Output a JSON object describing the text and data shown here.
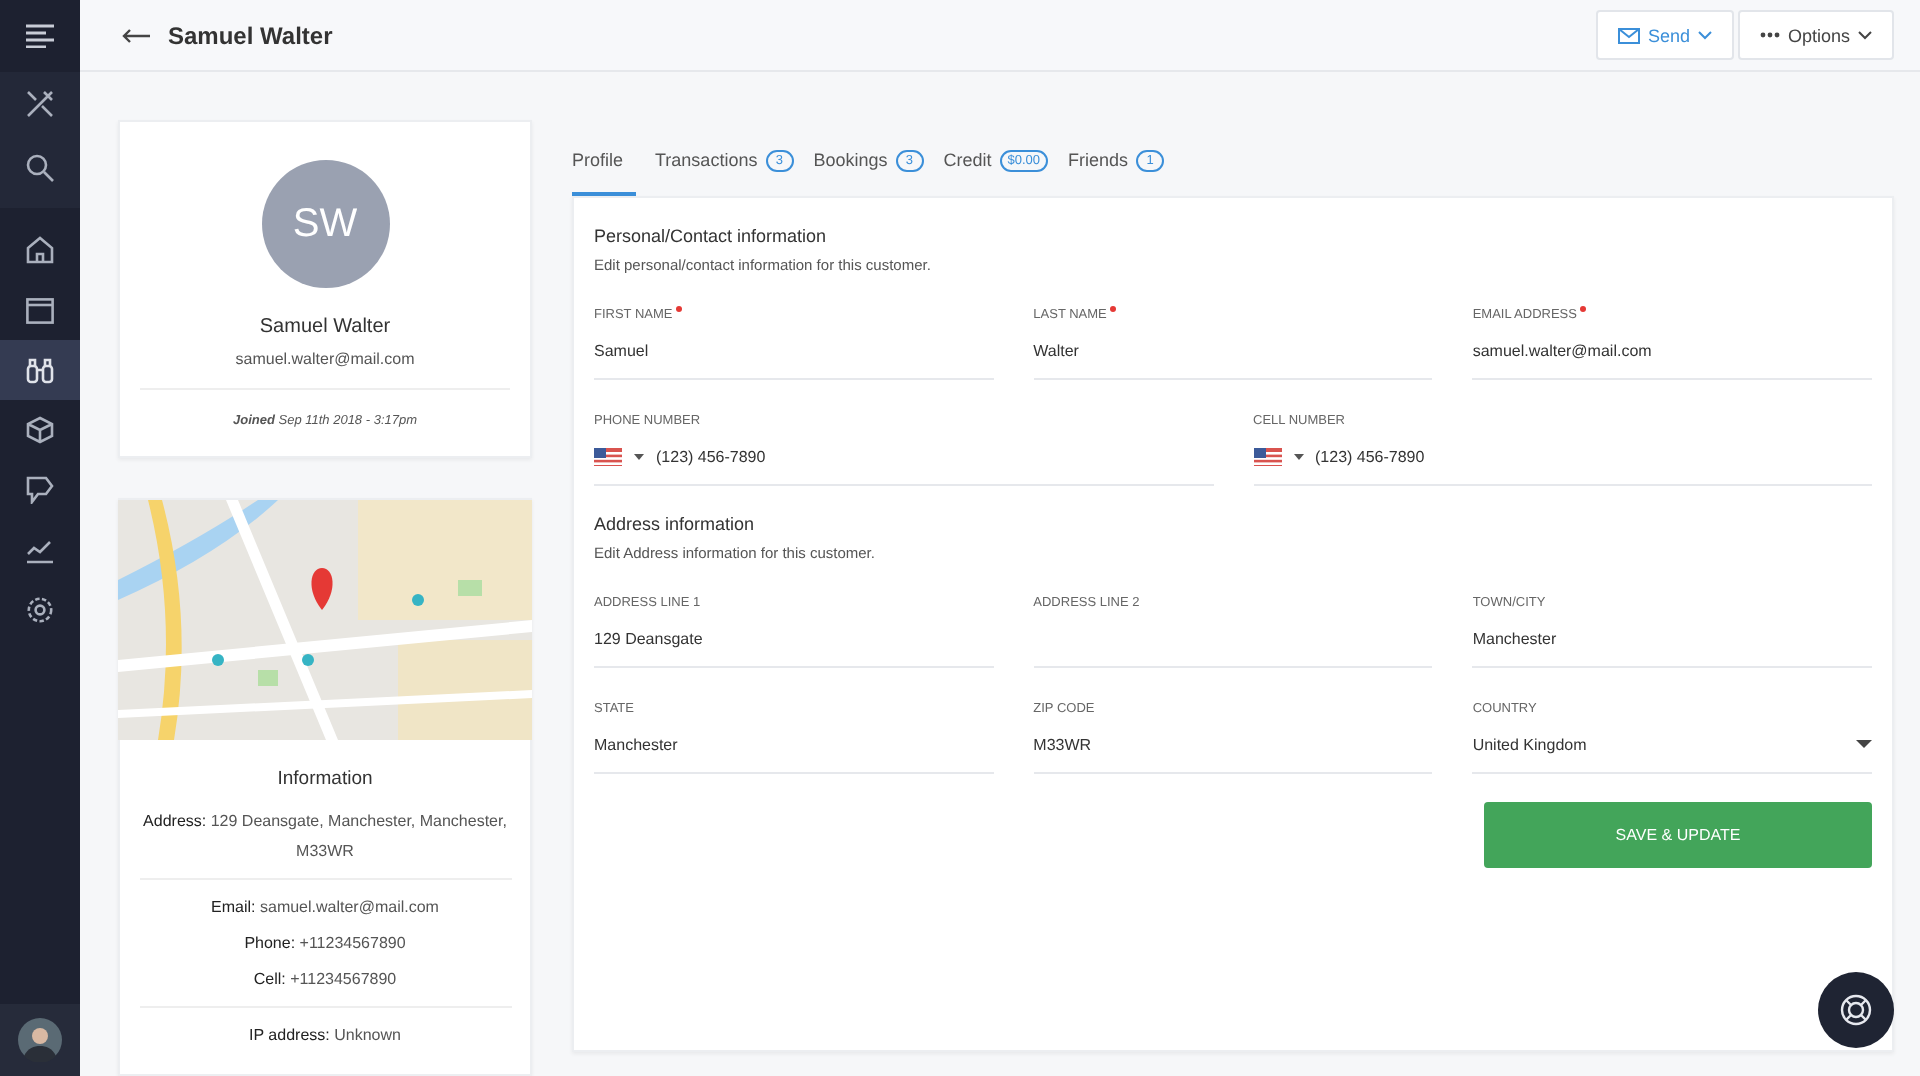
{
  "sidebar": {
    "items": [
      {
        "selected": false
      },
      {
        "selected": false
      },
      {
        "selected": false
      },
      {
        "selected": false
      },
      {
        "selected": false
      },
      {
        "selected": true
      },
      {
        "selected": false
      },
      {
        "selected": false
      },
      {
        "selected": false
      },
      {
        "selected": false
      }
    ]
  },
  "header": {
    "title": "Samuel Walter",
    "buttons": [
      {
        "label": "Send"
      },
      {
        "label": "Options"
      }
    ]
  },
  "profile": {
    "initials": "SW",
    "name": "Samuel Walter",
    "email": "samuel.walter@mail.com",
    "joined_label": "Joined",
    "joined": "Sep 11th 2018 - 3:17pm"
  },
  "info": {
    "map": {
      "kind": "picture"
    },
    "title": "Information",
    "groups": [
      [
        "**Address:** 129 Deansgate, Manchester, Manchester, M33WR"
      ],
      [
        "**Email:** samuel.walter@mail.com",
        "**Phone:** +11234567890",
        "**Cell:** +11234567890"
      ],
      [
        "**IP address:** Unknown"
      ]
    ]
  },
  "tabs": [
    {
      "label": "Profile",
      "selected": true
    },
    {
      "label": "Transactions",
      "badge": "3",
      "selected": false
    },
    {
      "label": "Bookings",
      "badge": "3",
      "selected": false
    },
    {
      "label": "Credit",
      "badge": "$0.00",
      "selected": false
    },
    {
      "label": "Friends",
      "badge": "1",
      "selected": false
    }
  ],
  "sections": [
    {
      "title": "Personal/Contact information",
      "subtitle": "Edit personal/contact information for this customer.",
      "rows": [
        [
          {
            "label": "FIRST NAME",
            "required": true,
            "value": "Samuel",
            "kind": "text"
          },
          {
            "label": "LAST NAME",
            "required": true,
            "value": "Walter",
            "kind": "text"
          },
          {
            "label": "EMAIL ADDRESS",
            "required": true,
            "value": "samuel.walter@mail.com",
            "kind": "text"
          }
        ],
        [
          {
            "label": "PHONE NUMBER",
            "required": false,
            "value": "(123) 456-7890",
            "kind": "phone"
          },
          {
            "label": "CELL NUMBER",
            "required": false,
            "value": "(123) 456-7890",
            "kind": "phone"
          }
        ]
      ]
    },
    {
      "title": "Address information",
      "subtitle": "Edit Address information for this customer.",
      "rows": [
        [
          {
            "label": "ADDRESS LINE 1",
            "required": false,
            "value": "129 Deansgate",
            "kind": "text"
          },
          {
            "label": "ADDRESS LINE 2",
            "required": false,
            "kind": "text"
          },
          {
            "label": "TOWN/CITY",
            "required": false,
            "value": "Manchester",
            "kind": "text"
          }
        ],
        [
          {
            "label": "STATE",
            "required": false,
            "value": "Manchester",
            "kind": "text"
          },
          {
            "label": "ZIP CODE",
            "required": false,
            "value": "M33WR",
            "kind": "text"
          },
          {
            "label": "COUNTRY",
            "required": false,
            "value": "United Kingdom",
            "kind": "select"
          }
        ]
      ]
    }
  ],
  "save_button": "SAVE & UPDATE"
}
